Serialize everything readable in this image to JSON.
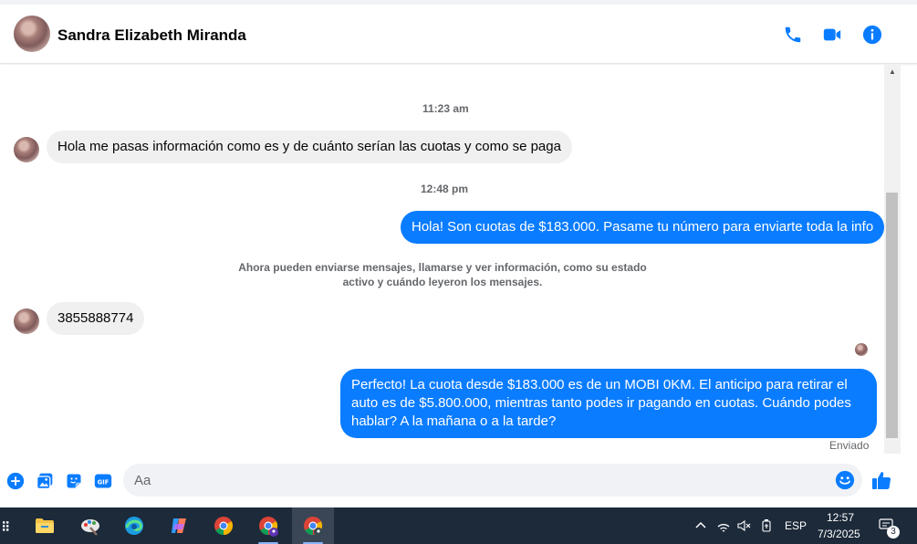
{
  "header": {
    "contact_name": "Sandra Elizabeth Miranda"
  },
  "chat": {
    "time_1": "11:23 am",
    "msg_in_1": "Hola me pasas información como es y de cuánto serían las cuotas y como se paga",
    "time_2": "12:48 pm",
    "msg_out_1": "Hola! Son cuotas de $183.000. Pasame tu número para enviarte toda la info",
    "system_note_line1": "Ahora pueden enviarse mensajes, llamarse y ver información, como su estado",
    "system_note_line2": "activo y cuándo leyeron los mensajes.",
    "msg_in_2": "3855888774",
    "msg_out_2": "Perfecto! La cuota desde $183.000 es de un MOBI 0KM. El anticipo para retirar el auto es de $5.800.000, mientras tanto podes ir pagando en cuotas. Cuándo podes hablar? A la mañana o a la tarde?",
    "sent_status": "Enviado"
  },
  "composer": {
    "placeholder": "Aa"
  },
  "taskbar": {
    "language": "ESP",
    "time": "12:57",
    "date": "7/3/2025",
    "notification_count": "3"
  },
  "colors": {
    "accent": "#0a7cff",
    "incoming_bubble": "#f0f0f0",
    "taskbar_bg": "#1c2a3a"
  }
}
